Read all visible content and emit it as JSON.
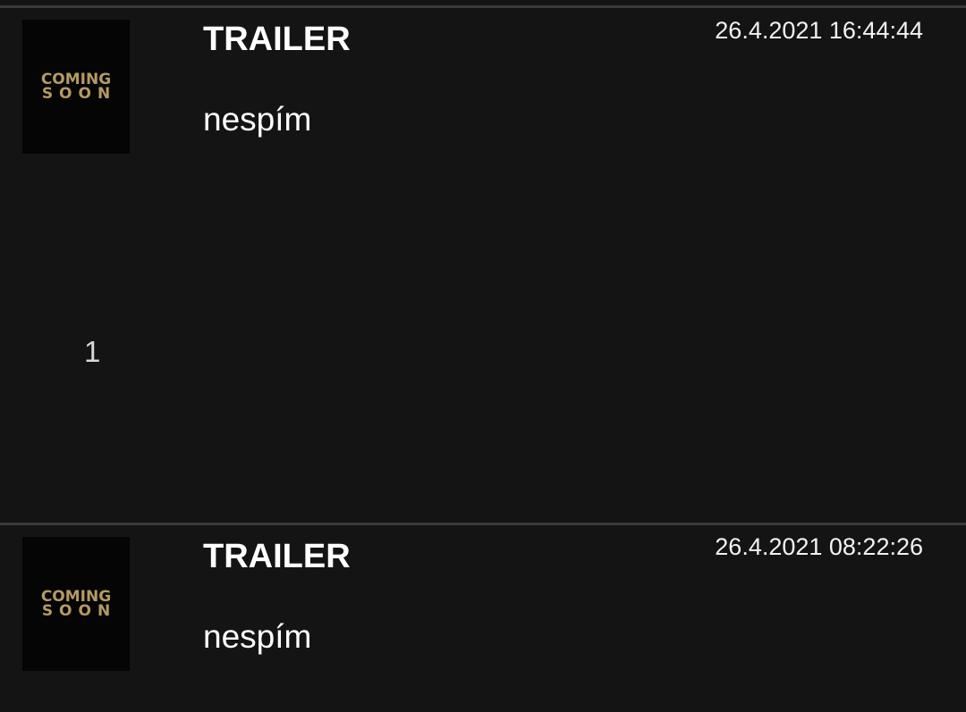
{
  "items": [
    {
      "poster": {
        "line1": "COMING",
        "line2": "SOON"
      },
      "title": "TRAILER",
      "timestamp": "26.4.2021 16:44:44",
      "comment": "nespím",
      "count": "1"
    },
    {
      "poster": {
        "line1": "COMING",
        "line2": "SOON"
      },
      "title": "TRAILER",
      "timestamp": "26.4.2021 08:22:26",
      "comment": "nespím"
    }
  ],
  "colors": {
    "background": "#141414",
    "divider": "#3a3a3a",
    "poster_text": "#b59a63"
  }
}
